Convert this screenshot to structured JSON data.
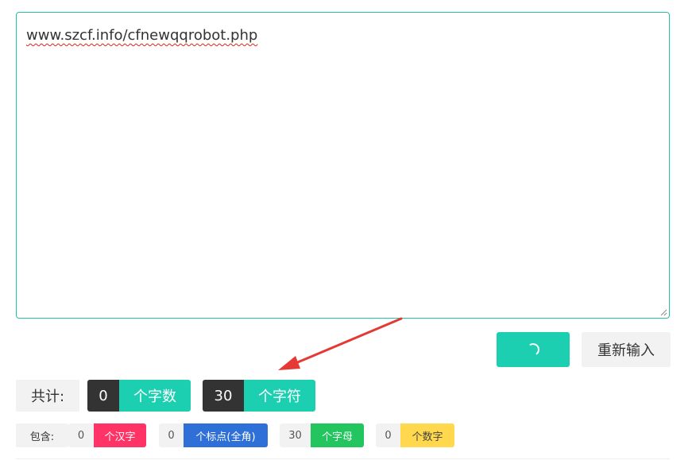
{
  "editor": {
    "text": "www.szcf.info/cfnewqqrobot.php"
  },
  "buttons": {
    "submit_icon": "loading-spinner-icon",
    "reset_label": "重新输入"
  },
  "totals": {
    "label": "共计:",
    "chinese_words": {
      "count": "0",
      "label": "个字数"
    },
    "characters": {
      "count": "30",
      "label": "个字符"
    }
  },
  "details": {
    "label": "包含:",
    "items": [
      {
        "count": "0",
        "label": "个汉字",
        "color": "#ff3366"
      },
      {
        "count": "0",
        "label": "个标点(全角)",
        "color": "#2e6fd8"
      },
      {
        "count": "30",
        "label": "个字母",
        "color": "#22c55e"
      },
      {
        "count": "0",
        "label": "个数字",
        "color": "#ffd84d"
      }
    ]
  },
  "colors": {
    "accent": "#1ccfb0",
    "dark": "#333333",
    "annotation_arrow": "#e53935"
  }
}
